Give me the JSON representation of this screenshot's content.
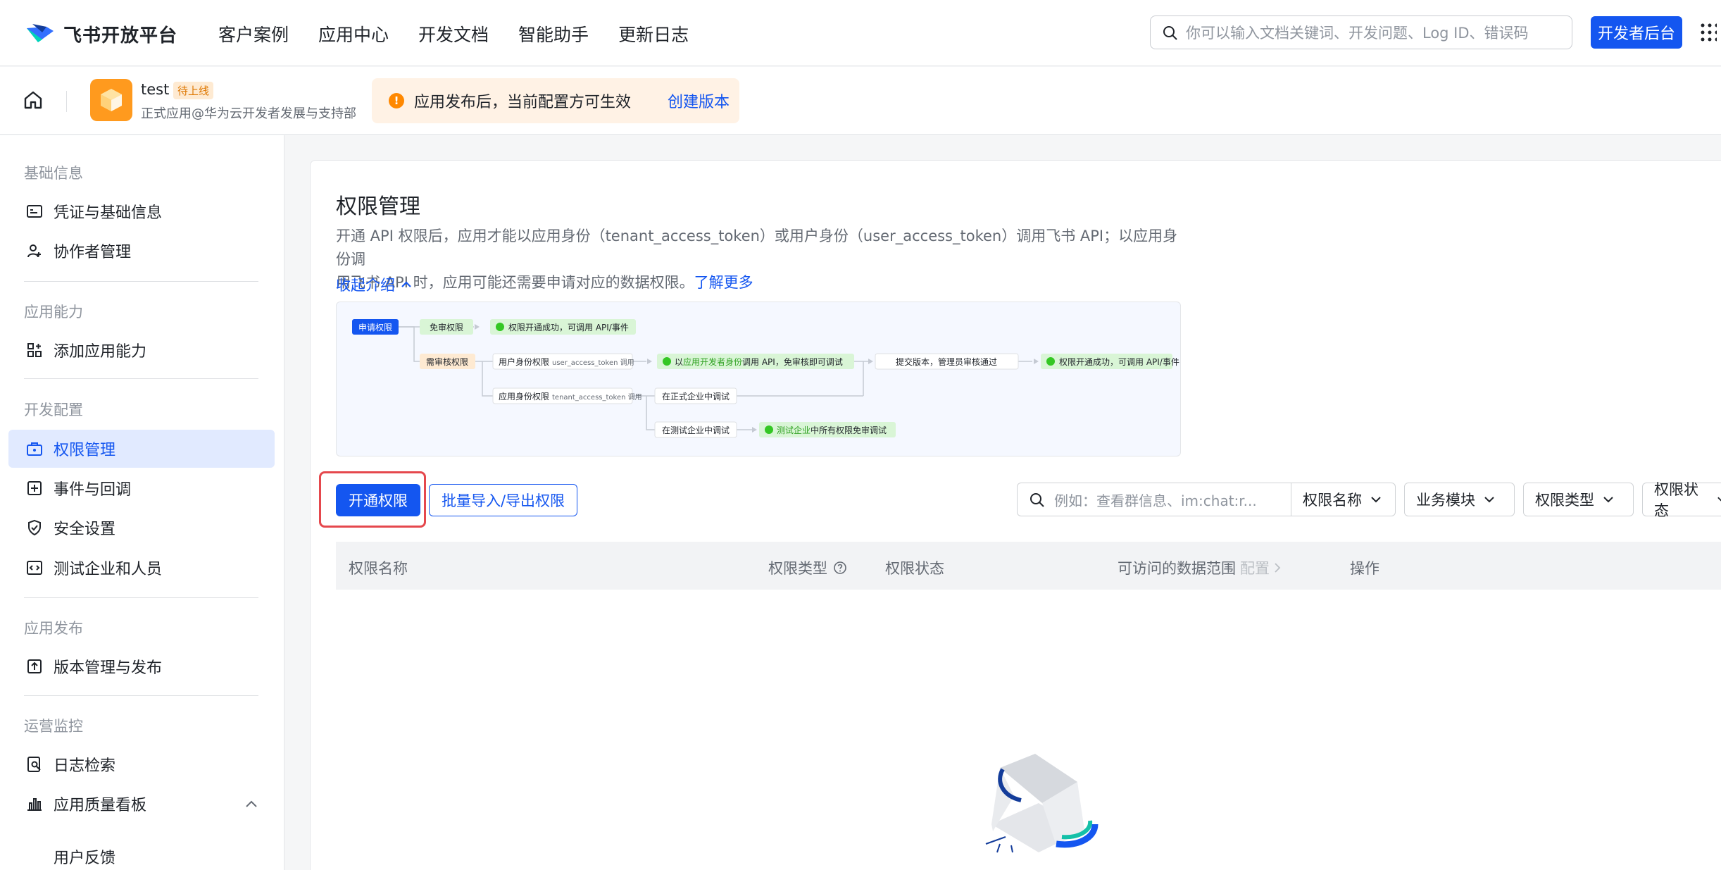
{
  "topnav": {
    "logo_text": "飞书开放平台",
    "links": [
      "客户案例",
      "应用中心",
      "开发文档",
      "智能助手",
      "更新日志"
    ],
    "search_placeholder": "你可以输入文档关键词、开发问题、Log ID、错误码",
    "dev_button": "开发者后台"
  },
  "appbar": {
    "app_name": "test",
    "app_status": "待上线",
    "app_org": "正式应用@华为云开发者发展与支持部",
    "notice_text": "应用发布后，当前配置方可生效",
    "notice_link": "创建版本"
  },
  "sidebar": {
    "sections": [
      {
        "title": "基础信息",
        "items": [
          "凭证与基础信息",
          "协作者管理"
        ]
      },
      {
        "title": "应用能力",
        "items": [
          "添加应用能力"
        ]
      },
      {
        "title": "开发配置",
        "items": [
          "权限管理",
          "事件与回调",
          "安全设置",
          "测试企业和人员"
        ]
      },
      {
        "title": "应用发布",
        "items": [
          "版本管理与发布"
        ]
      },
      {
        "title": "运营监控",
        "items": [
          "日志检索",
          "应用质量看板"
        ]
      }
    ],
    "sub_item": "用户反馈",
    "active_item": "权限管理"
  },
  "main": {
    "title": "权限管理",
    "desc_1": "开通 API 权限后，应用才能以应用身份（tenant_access_token）或用户身份（user_access_token）调用飞书 API；以应用身份调",
    "desc_2": "用飞书 API 时，应用可能还需要申请对应的数据权限。",
    "learn_more": "了解更多",
    "collapse": "收起介绍",
    "flow": {
      "apply": "申请权限",
      "free": "免审权限",
      "free_result": "权限开通成功，可调用 API/事件",
      "review": "需审核权限",
      "user_id": "用户身份权限",
      "user_token": "user_access_token 调用",
      "app_id": "应用身份权限",
      "app_token": "tenant_access_token 调用",
      "dev_call_a": "以",
      "dev_call_b": "应用开发者身份",
      "dev_call_c": "调用 API，免审核即可调试",
      "submit": "提交版本，管理员审核通过",
      "final": "权限开通成功，可调用 API/事件",
      "prod_debug": "在正式企业中调试",
      "test_debug": "在测试企业中调试",
      "test_free_a": "测试企业",
      "test_free_b": "中所有权限免审调试"
    },
    "btn_open": "开通权限",
    "btn_batch": "批量导入/导出权限",
    "filter_placeholder": "例如：查看群信息、im:chat:r...",
    "filters": [
      "权限名称",
      "业务模块",
      "权限类型",
      "权限状态"
    ],
    "columns": [
      "权限名称",
      "权限类型",
      "权限状态",
      "可访问的数据范围",
      "配置",
      "操作"
    ]
  }
}
